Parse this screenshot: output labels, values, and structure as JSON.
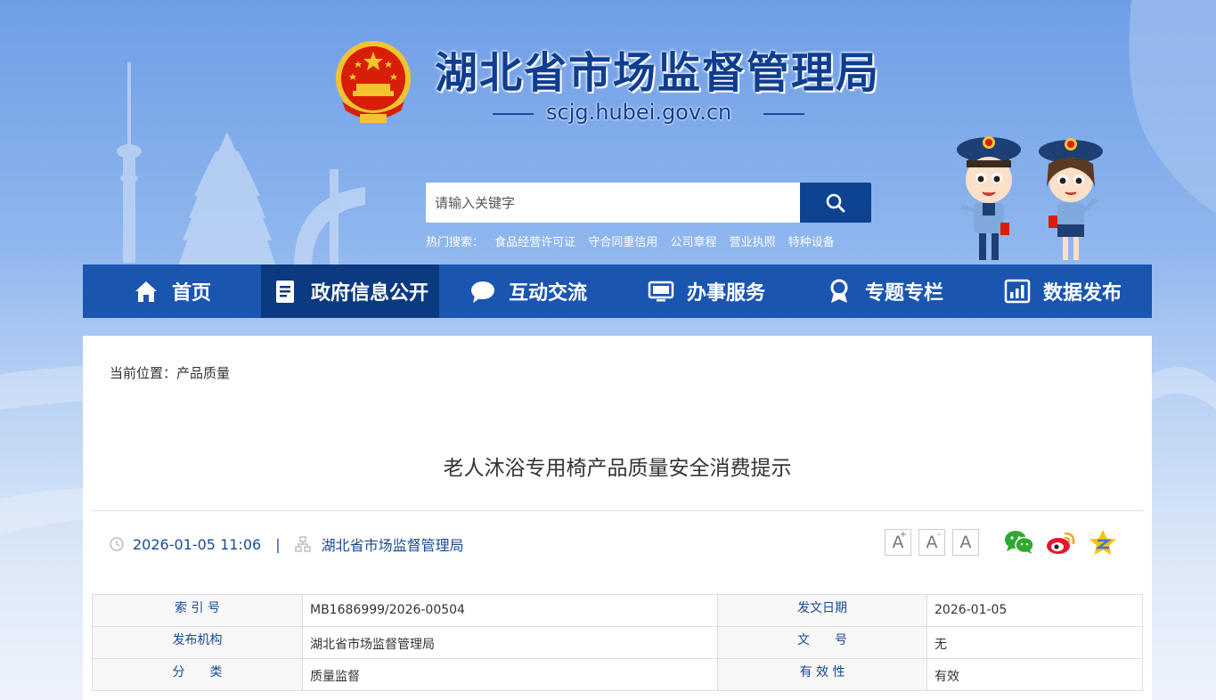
{
  "header": {
    "site_title": "湖北省市场监督管理局",
    "site_domain": "scjg.hubei.gov.cn",
    "search_placeholder": "请输入关键字",
    "hot_label": "热门搜索：",
    "hot_items": [
      "食品经营许可证",
      "守合同重信用",
      "公司章程",
      "营业执照",
      "特种设备"
    ]
  },
  "nav": [
    {
      "label": "首页",
      "icon": "home-icon"
    },
    {
      "label": "政府信息公开",
      "icon": "document-icon",
      "active": true
    },
    {
      "label": "互动交流",
      "icon": "chat-bubble-icon"
    },
    {
      "label": "办事服务",
      "icon": "monitor-icon"
    },
    {
      "label": "专题专栏",
      "icon": "ribbon-icon"
    },
    {
      "label": "数据发布",
      "icon": "bar-chart-icon"
    }
  ],
  "breadcrumb": {
    "prefix": "当前位置：",
    "current": "产品质量"
  },
  "article": {
    "title": "老人沐浴专用椅产品质量安全消费提示",
    "datetime": "2026-01-05 11:06",
    "separator": "|",
    "publisher": "湖北省市场监督管理局"
  },
  "font_sizes": [
    {
      "base": "A",
      "sup": "+"
    },
    {
      "base": "A",
      "sup": "-"
    },
    {
      "base": "A",
      "sup": ""
    }
  ],
  "share_icons": [
    "wechat-icon",
    "weibo-icon",
    "qzone-icon"
  ],
  "info_table": {
    "rows": [
      [
        {
          "label": "索 引 号",
          "value": "MB1686999/2026-00504"
        },
        {
          "label": "发文日期",
          "value": "2026-01-05"
        }
      ],
      [
        {
          "label": "发布机构",
          "value": "湖北省市场监督管理局"
        },
        {
          "label": "文　　号",
          "value": "无"
        }
      ],
      [
        {
          "label": "分　　类",
          "value": "质量监督"
        },
        {
          "label": "有 效 性",
          "value": "有效"
        }
      ]
    ]
  },
  "colors": {
    "nav_bg": "#1a55b0",
    "nav_active": "#0c3a80",
    "title_blue": "#0f3d8f",
    "search_btn": "#0e4391"
  }
}
